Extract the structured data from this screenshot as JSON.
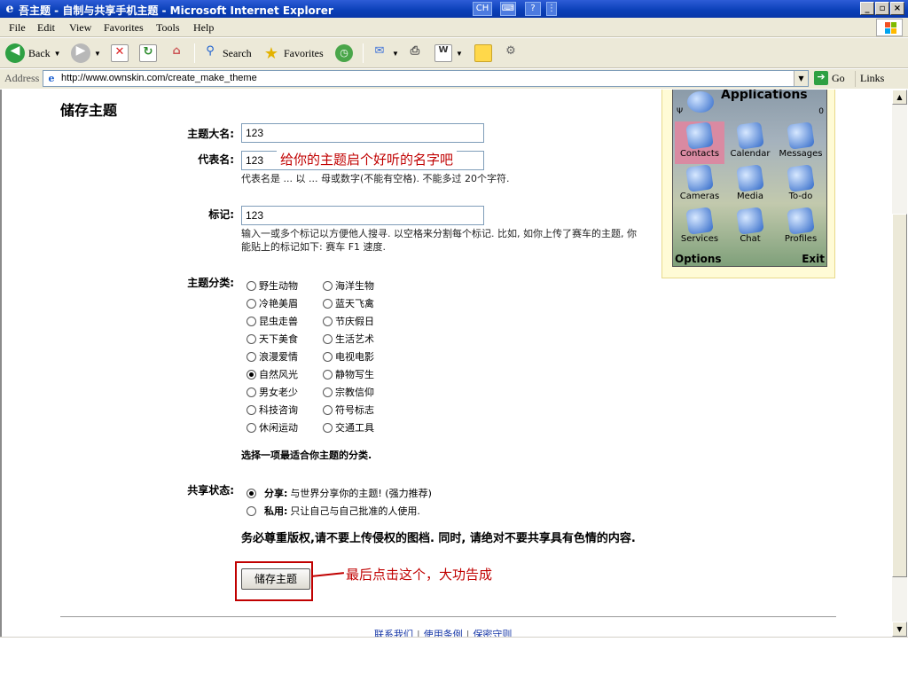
{
  "window": {
    "title": "吾主题 - 自制与共享手机主题 - Microsoft Internet Explorer",
    "lang_indicator": "CH",
    "controls": [
      "_",
      "▫",
      "×"
    ]
  },
  "menu": [
    "File",
    "Edit",
    "View",
    "Favorites",
    "Tools",
    "Help"
  ],
  "toolbar": {
    "back": "Back",
    "search": "Search",
    "favorites": "Favorites"
  },
  "address": {
    "label": "Address",
    "url": "http://www.ownskin.com/create_make_theme",
    "go": "Go",
    "links": "Links"
  },
  "form": {
    "heading": "储存主题",
    "title_label": "主题大名:",
    "title_value": "123",
    "title_annotation": "给你的主题启个好听的名字吧",
    "code_label": "代表名:",
    "code_value": "123",
    "code_help": "代表名是 ... 以 ... 母或数字(不能有空格). 不能多过 20个字符.",
    "tags_label": "标记:",
    "tags_value": "123",
    "tags_help": "输入一或多个标记以方便他人搜寻. 以空格来分割每个标记. 比如, 如你上传了赛车的主题, 你能贴上的标记如下: 赛车 F1 速度.",
    "category_label": "主题分类:",
    "categories_left": [
      "野生动物",
      "冷艳美眉",
      "昆虫走兽",
      "天下美食",
      "浪漫爱情",
      "自然风光",
      "男女老少",
      "科技咨询",
      "休闲运动"
    ],
    "categories_right": [
      "海洋生物",
      "蓝天飞禽",
      "节庆假日",
      "生活艺术",
      "电视电影",
      "静物写生",
      "宗教信仰",
      "符号标志",
      "交通工具"
    ],
    "selected_category": "自然风光",
    "category_note": "选择一项最适合你主题的分类.",
    "share_label": "共享状态:",
    "share_option_label": "分享:",
    "share_option_text": "与世界分享你的主题! (强力推荐)",
    "private_option_label": "私用:",
    "private_option_text": "只让自己与自己批准的人使用.",
    "warning": "务必尊重版权,请不要上传侵权的图档. 同时, 请绝对不要共享具有色情的内容.",
    "submit_label": "储存主题",
    "submit_annotation": "最后点击这个，大功告成"
  },
  "footer": {
    "links": [
      "联系我们",
      "使用条例",
      "保密守则"
    ]
  },
  "preview": {
    "header": "Applications",
    "counter": "0",
    "apps": [
      "Contacts",
      "Calendar",
      "Messages",
      "Cameras",
      "Media",
      "To-do",
      "Services",
      "Chat",
      "Profiles"
    ],
    "selected_app": "Contacts",
    "soft_left": "Options",
    "soft_right": "Exit"
  }
}
